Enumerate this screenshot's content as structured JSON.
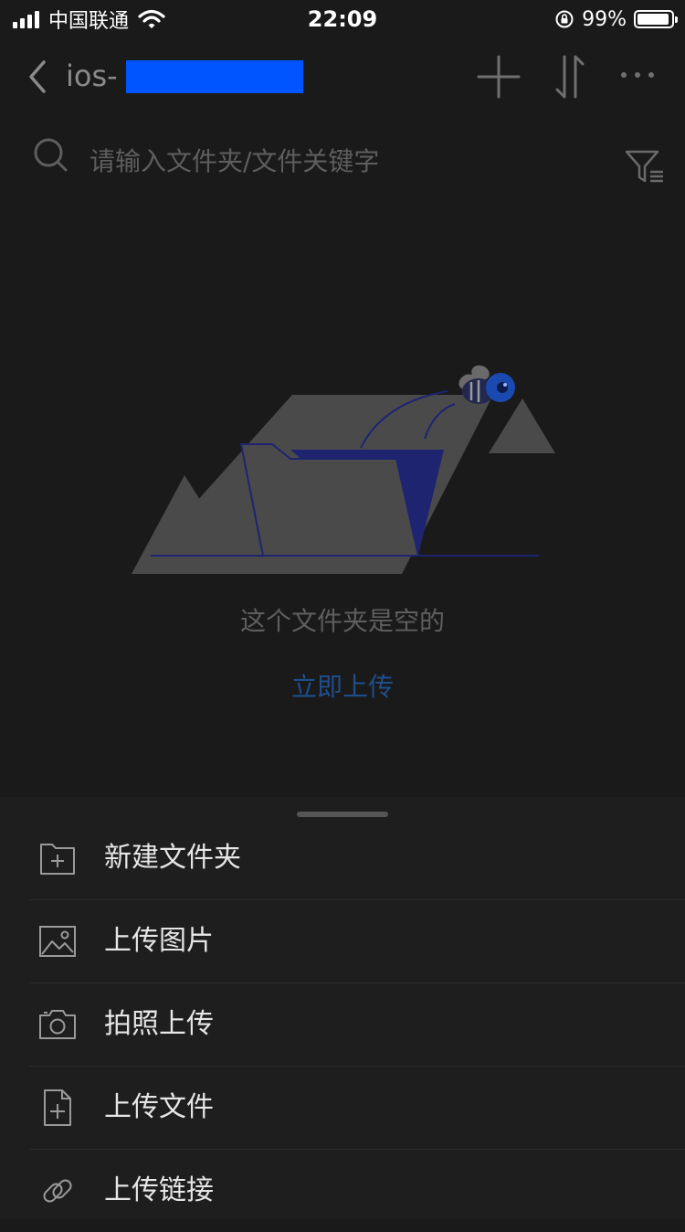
{
  "status_bar": {
    "carrier": "中国联通",
    "time": "22:09",
    "battery": "99%"
  },
  "nav": {
    "title": "ios-"
  },
  "search": {
    "placeholder": "请输入文件夹/文件关键字"
  },
  "empty_state": {
    "message": "这个文件夹是空的",
    "action": "立即上传"
  },
  "sheet": {
    "items": [
      {
        "label": "新建文件夹",
        "icon": "new-folder-icon"
      },
      {
        "label": "上传图片",
        "icon": "image-icon"
      },
      {
        "label": "拍照上传",
        "icon": "camera-icon"
      },
      {
        "label": "上传文件",
        "icon": "file-add-icon"
      },
      {
        "label": "上传链接",
        "icon": "link-icon"
      }
    ]
  },
  "colors": {
    "background": "#1a1a1a",
    "accent": "#1f4e8c",
    "redaction": "#0054ff"
  }
}
